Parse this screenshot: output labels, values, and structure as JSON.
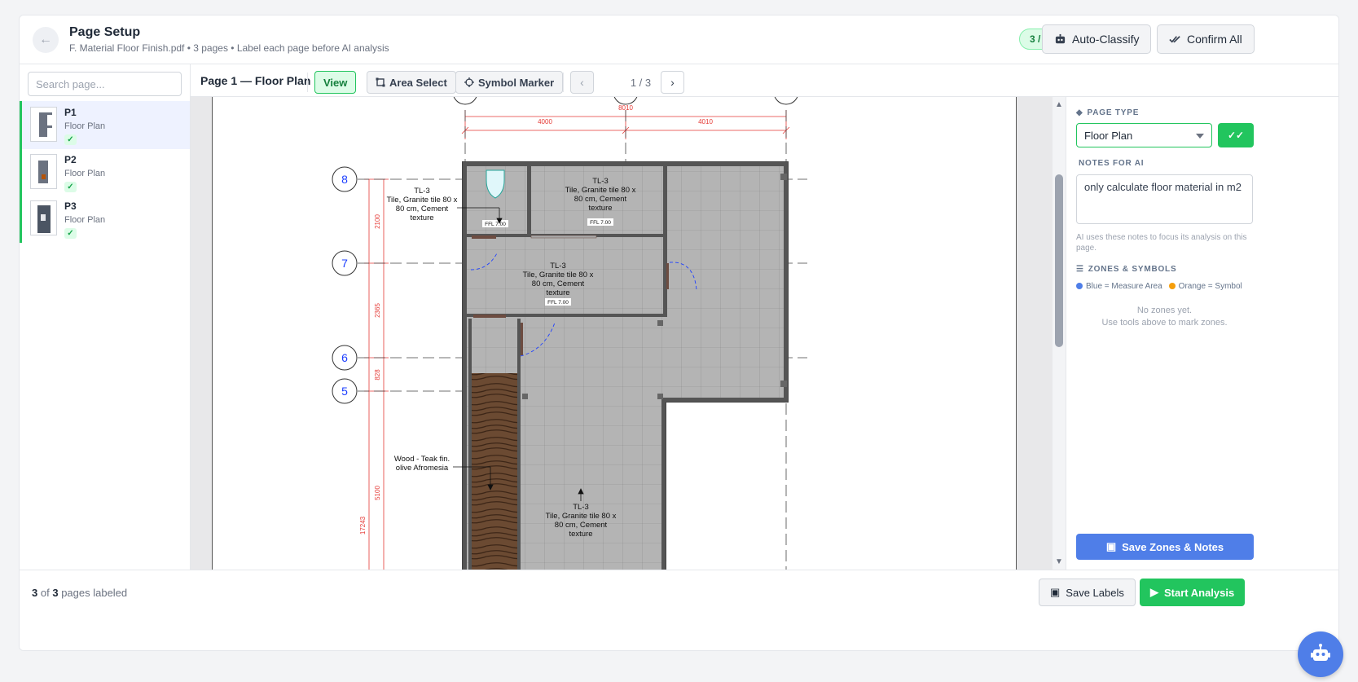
{
  "header": {
    "title": "Page Setup",
    "subtitle": "F. Material Floor Finish.pdf • 3 pages • Label each page before AI analysis",
    "labeled_badge": "3 / 3 labeled",
    "auto_classify_label": "Auto-Classify",
    "confirm_all_label": "Confirm All"
  },
  "sidebar": {
    "search_placeholder": "Search page...",
    "pages": [
      {
        "name": "P1",
        "type": "Floor Plan",
        "active": true
      },
      {
        "name": "P2",
        "type": "Floor Plan",
        "active": false
      },
      {
        "name": "P3",
        "type": "Floor Plan",
        "active": false
      }
    ]
  },
  "toolbar": {
    "title": "Page 1 — Floor Plan",
    "view_label": "View",
    "area_select_label": "Area Select",
    "symbol_marker_label": "Symbol Marker",
    "page_indicator": "1 / 3"
  },
  "drawing": {
    "dims": {
      "top_total": "8010",
      "top_left": "4000",
      "top_right": "4010",
      "v1": "2100",
      "v2": "2365",
      "v3": "828",
      "v4": "5100",
      "v5": "17243"
    },
    "grid_labels": [
      "8",
      "7",
      "6",
      "5"
    ],
    "ffl": "FFL 7.00",
    "tile_code": "TL-3",
    "tile_l1": "Tile, Granite tile 80 x",
    "tile_l2": "80 cm, Cement",
    "tile_l3": "texture",
    "wood_l1": "Wood - Teak fin.",
    "wood_l2": "olive Afromesia"
  },
  "panel": {
    "page_type_heading": "PAGE TYPE",
    "page_type_value": "Floor Plan",
    "notes_heading": "NOTES FOR AI",
    "notes_value": "only calculate floor material in m2",
    "notes_hint": "AI uses these notes to focus its analysis on this page.",
    "zones_heading": "ZONES & SYMBOLS",
    "legend_blue": "Blue = Measure Area",
    "legend_orange": "Orange = Symbol",
    "empty_line1": "No zones yet.",
    "empty_line2": "Use tools above to mark zones.",
    "save_zones_label": "Save Zones & Notes",
    "colors": {
      "blue": "#4f7ee8",
      "orange": "#f59e0b",
      "green": "#22c55e"
    }
  },
  "footer": {
    "labeled_count": "3",
    "of_text": "of",
    "total_count": "3",
    "suffix_text": "pages labeled",
    "save_labels_label": "Save Labels",
    "start_analysis_label": "Start Analysis"
  }
}
